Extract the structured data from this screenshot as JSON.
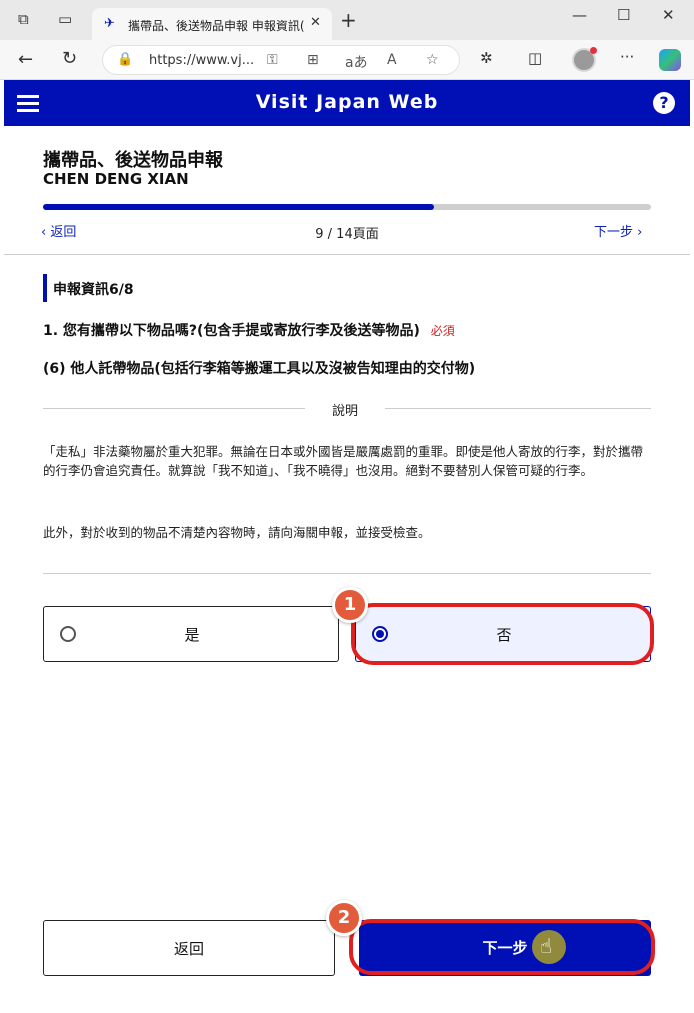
{
  "browser": {
    "tab_title": "攜帶品、後送物品申報 申報資訊(",
    "tab_close": "✕",
    "new_tab": "+",
    "url": "https://www.vj...",
    "icons": [
      "tab-actions-icon",
      "vertical-tabs-icon",
      "back-arrow-icon",
      "refresh-icon",
      "lock-icon",
      "key-icon",
      "apps-icon",
      "read-aloud-icon",
      "reader-mode-icon",
      "favorite-star-icon",
      "extensions-icon",
      "split-screen-icon",
      "profile-avatar",
      "more-icon",
      "copilot-icon"
    ]
  },
  "header": {
    "title": "Visit Japan Web",
    "help": "?"
  },
  "page": {
    "title": "攜帶品、後送物品申報",
    "user_name": "CHEN DENG XIAN",
    "progress_fraction": 0.643,
    "back_label": "返回",
    "page_counter": "9 / 14頁面",
    "next_label": "下一步"
  },
  "section": {
    "title": "申報資訊6/8",
    "question": "1. 您有攜帶以下物品嗎?(包含手提或寄放行李及後送等物品)",
    "required": "必須",
    "sub_question": "(6) 他人託帶物品(包括行李箱等搬運工具以及沒被告知理由的交付物)"
  },
  "explanation": {
    "label": "說明",
    "paragraph1": "「走私」非法藥物屬於重大犯罪。無論在日本或外國皆是嚴厲處罰的重罪。即使是他人寄放的行李，對於攜帶的行李仍會追究責任。就算說「我不知道」、「我不曉得」也沒用。絕對不要替別人保管可疑的行李。",
    "paragraph2": "此外，對於收到的物品不清楚內容物時，請向海關申報，並接受檢查。"
  },
  "options": {
    "yes": "是",
    "no": "否",
    "selected": "no"
  },
  "buttons": {
    "back": "返回",
    "next": "下一步"
  },
  "annotations": {
    "step1": "1",
    "step2": "2",
    "color": "#e02020"
  },
  "colors": {
    "brand": "#0010b4",
    "required": "#d21f1f"
  }
}
